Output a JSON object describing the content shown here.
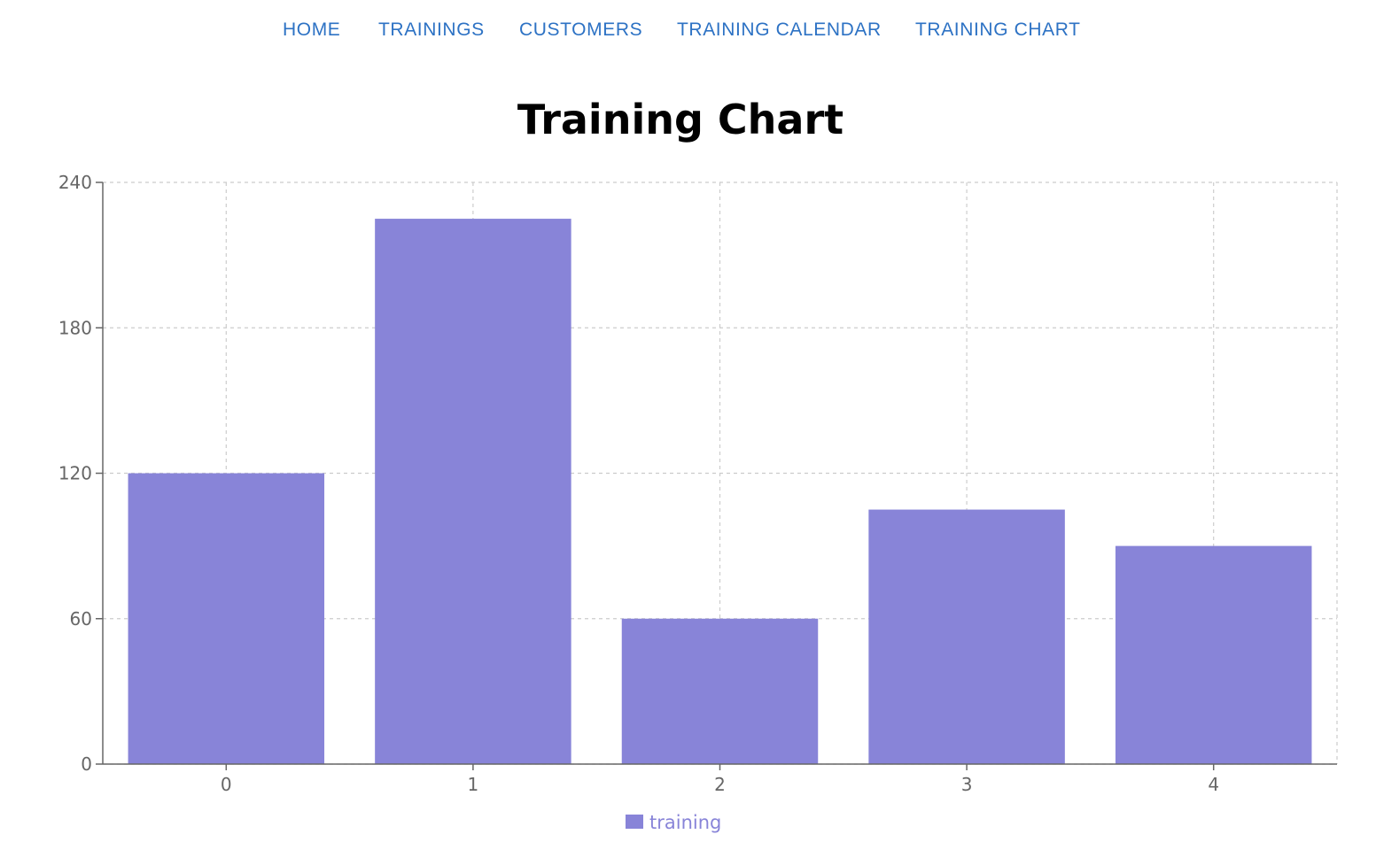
{
  "nav": {
    "items": [
      {
        "label": "HOME"
      },
      {
        "label": "TRAININGS"
      },
      {
        "label": "CUSTOMERS"
      },
      {
        "label": "TRAINING CALENDAR"
      },
      {
        "label": "TRAINING CHART"
      }
    ],
    "color": "#2d72c4"
  },
  "page_title": "Training Chart",
  "chart_data": {
    "type": "bar",
    "categories": [
      "0",
      "1",
      "2",
      "3",
      "4"
    ],
    "series": [
      {
        "name": "training",
        "values": [
          120,
          225,
          60,
          105,
          90
        ],
        "color": "#8884d8"
      }
    ],
    "ylim": [
      0,
      240
    ],
    "yticks": [
      0,
      60,
      120,
      180,
      240
    ],
    "grid": true,
    "legend": "bottom-center",
    "xlabel": "",
    "ylabel": ""
  }
}
